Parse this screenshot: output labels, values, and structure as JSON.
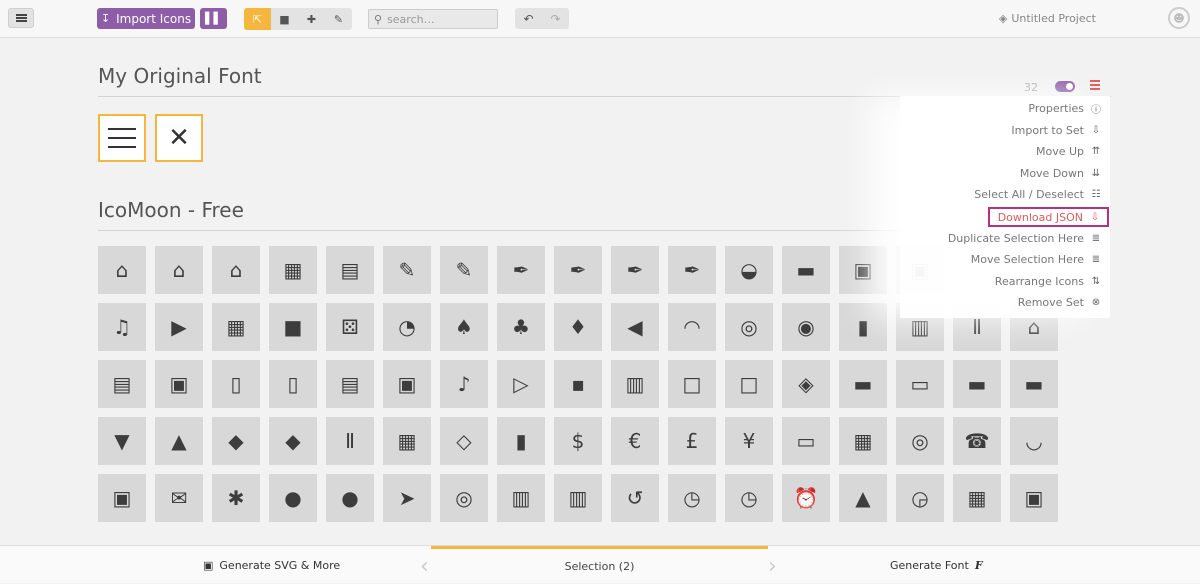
{
  "toolbar": {
    "import_label": "Import Icons",
    "search_placeholder": "search…",
    "project_name": "Untitled Project"
  },
  "sets": [
    {
      "title": "My Original Font"
    },
    {
      "title": "IcoMoon - Free"
    }
  ],
  "set_header": {
    "count": "32"
  },
  "set_menu": {
    "items": [
      {
        "label": "Properties",
        "icon": "info-icon"
      },
      {
        "label": "Import to Set",
        "icon": "import-icon"
      },
      {
        "label": "Move Up",
        "icon": "move-up-icon"
      },
      {
        "label": "Move Down",
        "icon": "move-down-icon"
      },
      {
        "label": "Select All  /  Deselect",
        "icon": "grid-select-icon"
      },
      {
        "label": "Download JSON",
        "icon": "download-icon",
        "highlighted": true
      },
      {
        "label": "Duplicate Selection Here",
        "icon": "duplicate-icon"
      },
      {
        "label": "Move Selection Here",
        "icon": "move-selection-icon"
      },
      {
        "label": "Rearrange Icons",
        "icon": "rearrange-icon"
      },
      {
        "label": "Remove Set",
        "icon": "remove-icon"
      }
    ]
  },
  "bottombar": {
    "generate_svg": "Generate SVG & More",
    "selection": "Selection (2)",
    "generate_font": "Generate Font"
  },
  "colors": {
    "accent": "#8d5da7",
    "selection": "#f4b63f",
    "danger": "#e05a5a",
    "highlight_border": "#b5307d"
  },
  "icon_grid": [
    [
      "⌂",
      "⌂",
      "⌂",
      "▦",
      "▤",
      "✎",
      "✎",
      "✒",
      "✒",
      "✒",
      "✒",
      "◒",
      "▬",
      "▣",
      "▣"
    ],
    [
      "♫",
      "▶",
      "▦",
      "■",
      "⚄",
      "◔",
      "♠",
      "♣",
      "♦",
      "◀",
      "◠",
      "◎",
      "◉",
      "▮",
      "▥",
      "Ⅱ",
      "⌂"
    ],
    [
      "▤",
      "▣",
      "▯",
      "▯",
      "▤",
      "▣",
      "♪",
      "▷",
      "▪",
      "▥",
      "□",
      "□",
      "◈",
      "▬",
      "▭",
      "▬",
      "▬"
    ],
    [
      "▼",
      "▲",
      "◆",
      "◆",
      "Ⅱ",
      "▦",
      "◇",
      "▮",
      "$",
      "€",
      "£",
      "¥",
      "▭",
      "▦",
      "◎",
      "☎",
      "◡"
    ],
    [
      "▣",
      "✉",
      "✱",
      "●",
      "●",
      "➤",
      "◎",
      "▥",
      "▥",
      "↺",
      "◷",
      "◷",
      "⏰",
      "▲",
      "◶",
      "▦",
      "▣"
    ]
  ]
}
